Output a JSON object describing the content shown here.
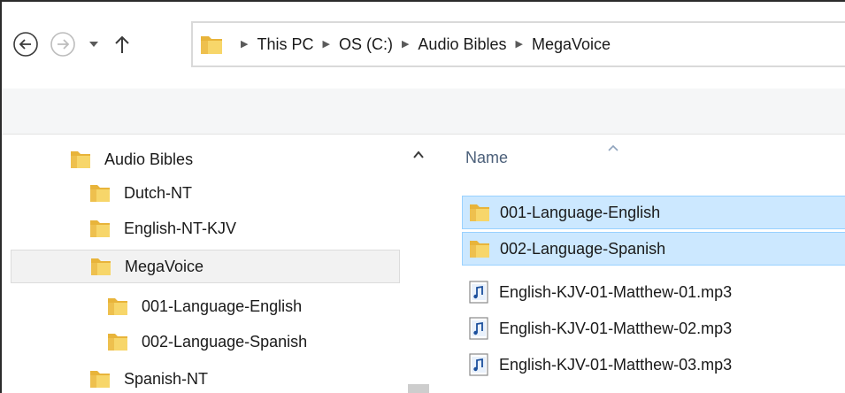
{
  "address_bar": {
    "crumbs": [
      "This PC",
      "OS (C:)",
      "Audio Bibles",
      "MegaVoice"
    ]
  },
  "nav_pane": {
    "items": [
      {
        "label": "Audio Bibles",
        "level": 0,
        "selected": false
      },
      {
        "label": "Dutch-NT",
        "level": 1,
        "selected": false
      },
      {
        "label": "English-NT-KJV",
        "level": 1,
        "selected": false
      },
      {
        "label": "MegaVoice",
        "level": 1,
        "selected": true
      },
      {
        "label": "001-Language-English",
        "level": 2,
        "selected": false
      },
      {
        "label": "002-Language-Spanish",
        "level": 2,
        "selected": false
      },
      {
        "label": "Spanish-NT",
        "level": 1,
        "selected": false
      }
    ]
  },
  "content": {
    "column_header": "Name",
    "files": [
      {
        "name": "001-Language-English",
        "type": "folder",
        "selected": true
      },
      {
        "name": "002-Language-Spanish",
        "type": "folder",
        "selected": true
      },
      {
        "name": "English-KJV-01-Matthew-01.mp3",
        "type": "audio",
        "selected": false
      },
      {
        "name": "English-KJV-01-Matthew-02.mp3",
        "type": "audio",
        "selected": false
      },
      {
        "name": "English-KJV-01-Matthew-03.mp3",
        "type": "audio",
        "selected": false
      }
    ]
  },
  "colors": {
    "selection_fill": "#cce8ff",
    "selection_border": "#99d1ff",
    "folder_yellow": "#f4c542",
    "header_text": "#4c607a"
  }
}
